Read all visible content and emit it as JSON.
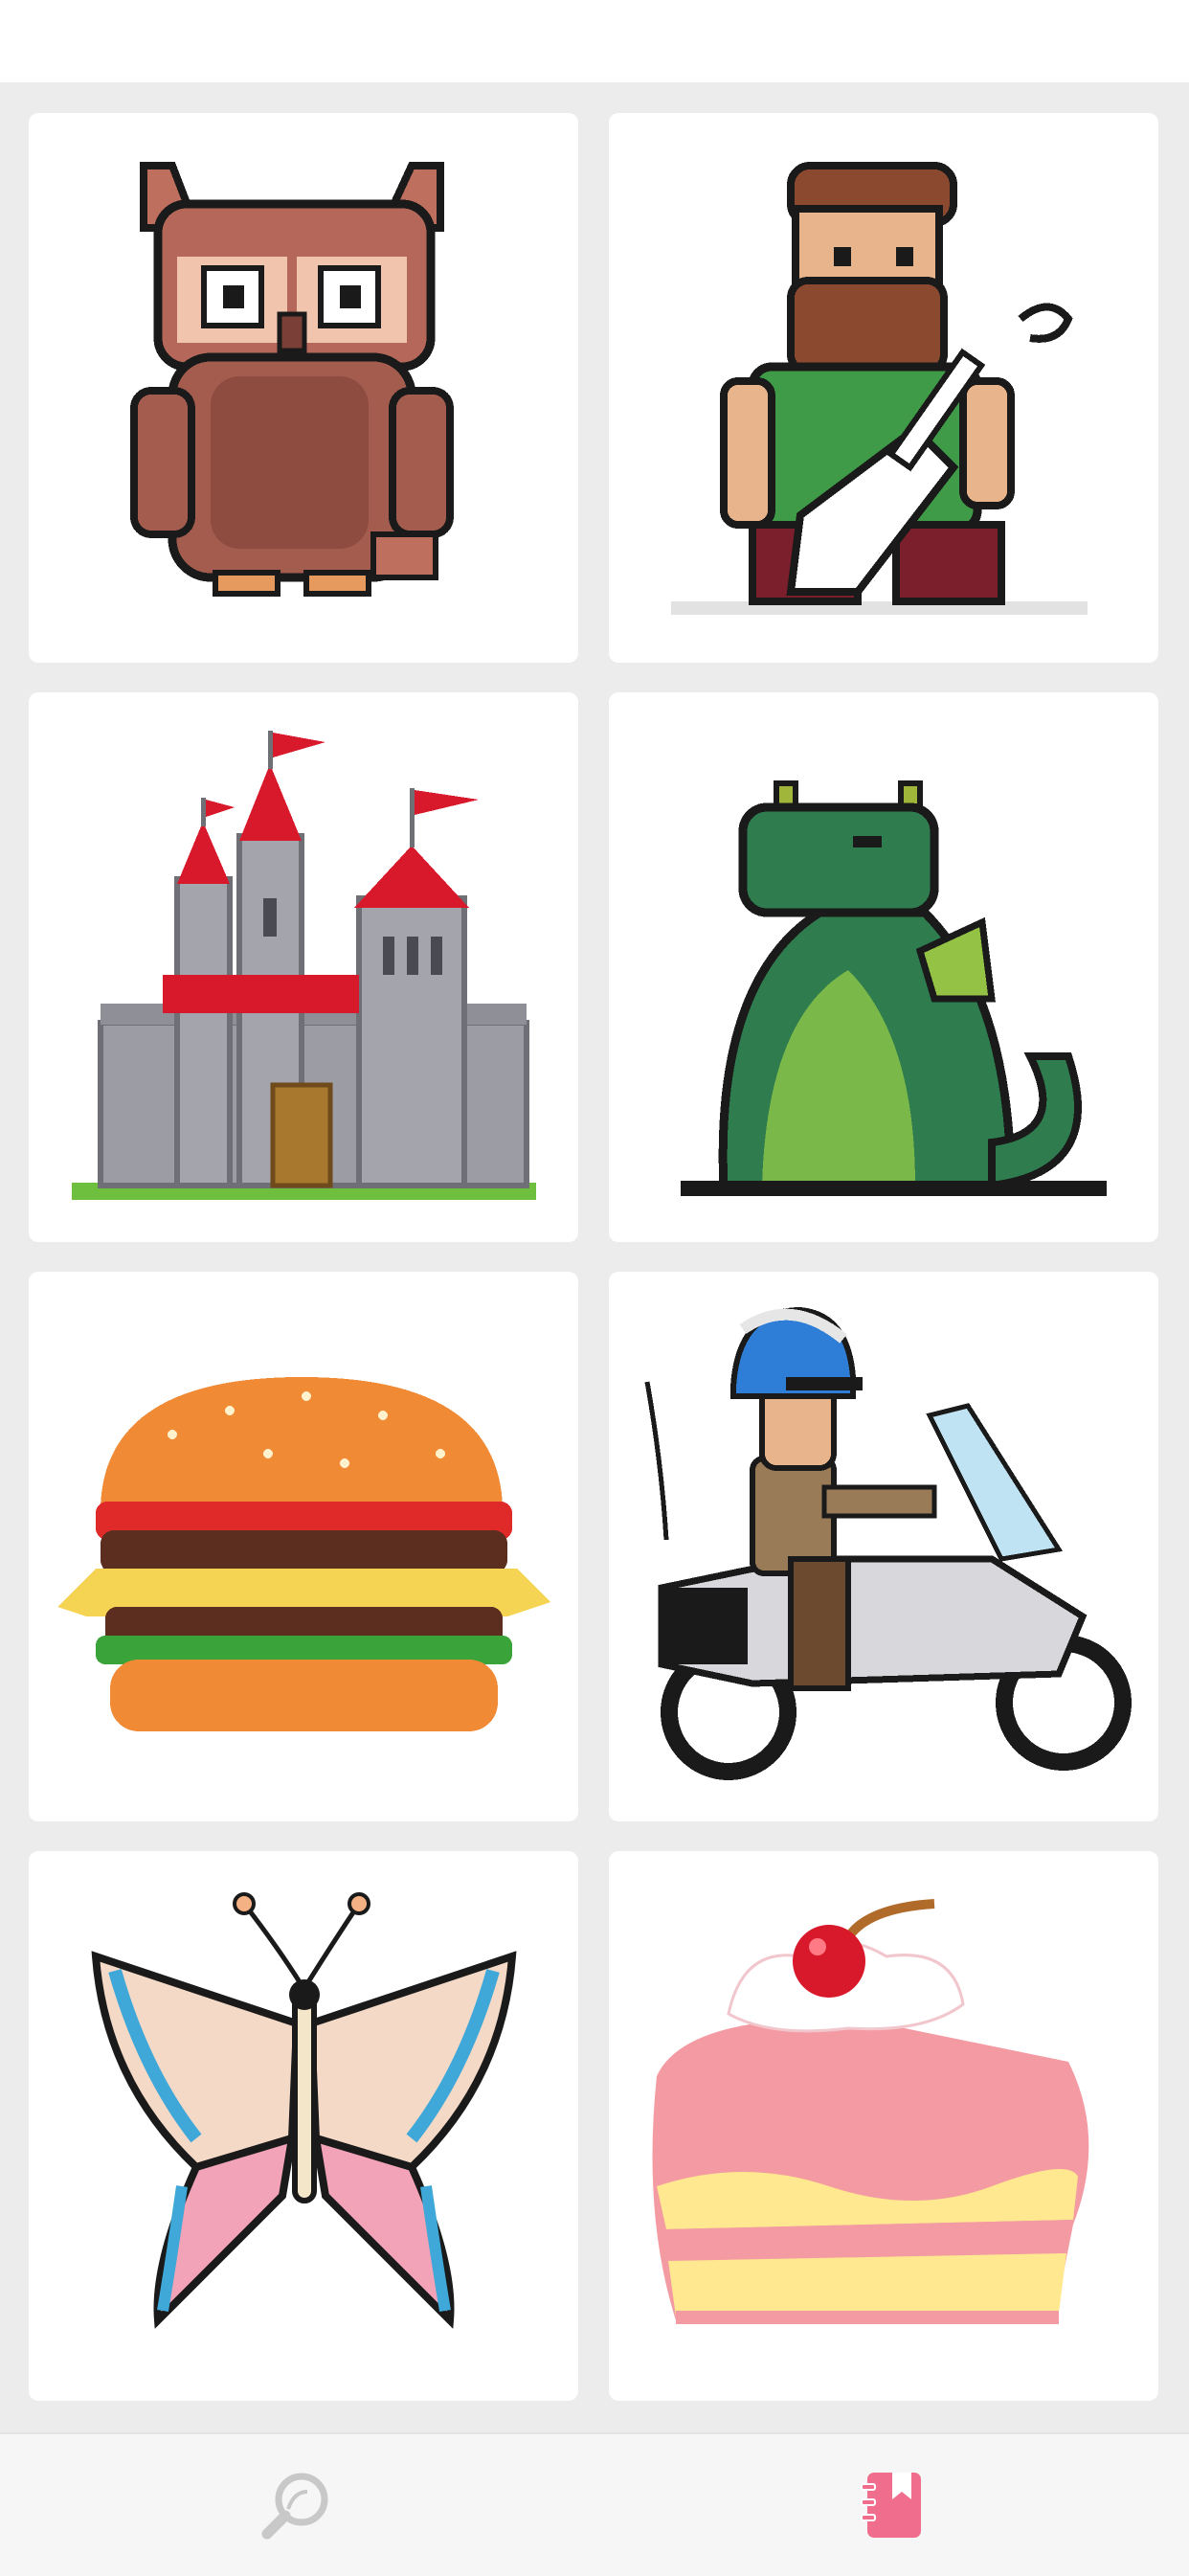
{
  "gallery": {
    "items": [
      {
        "subject": "owl"
      },
      {
        "subject": "bearded-guitarist"
      },
      {
        "subject": "castle"
      },
      {
        "subject": "dragon"
      },
      {
        "subject": "burger"
      },
      {
        "subject": "motorcycle-police"
      },
      {
        "subject": "butterfly"
      },
      {
        "subject": "cake-slice"
      }
    ]
  },
  "tabbar": {
    "tabs": [
      {
        "icon": "search-icon",
        "active": false
      },
      {
        "icon": "library-icon",
        "active": true
      }
    ],
    "active_color": "#f06d8e",
    "inactive_color": "#c8c8c8"
  }
}
